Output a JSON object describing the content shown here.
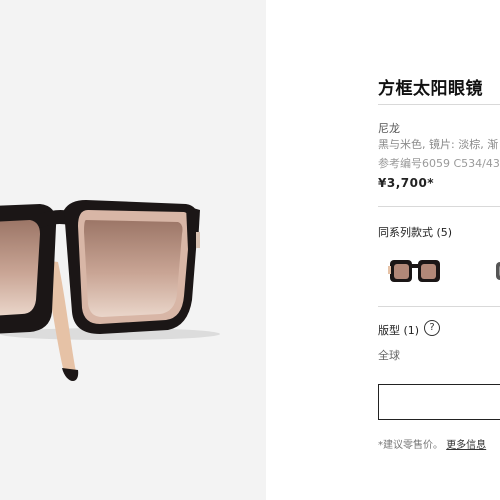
{
  "product": {
    "title": "方框太阳眼镜",
    "material": "尼龙",
    "description": "黑与米色, 镜片: 淡棕, 渐",
    "reference": "参考编号6059 C534/43,",
    "price": "¥3,700*"
  },
  "series": {
    "label": "同系列款式 (5)"
  },
  "size": {
    "label": "版型 (1)",
    "help_icon": "?",
    "value": "全球"
  },
  "footer": {
    "note_prefix": "*建议零售价。",
    "more_info_link": "更多信息"
  },
  "colors": {
    "frame": "#1b1616",
    "temple_beige": "#e6c2a6",
    "lens_top": "#b08a78",
    "lens_bottom": "#e3cbbd",
    "panel_bg": "#f3f3f3"
  },
  "icons": [
    "question-circle-icon"
  ]
}
